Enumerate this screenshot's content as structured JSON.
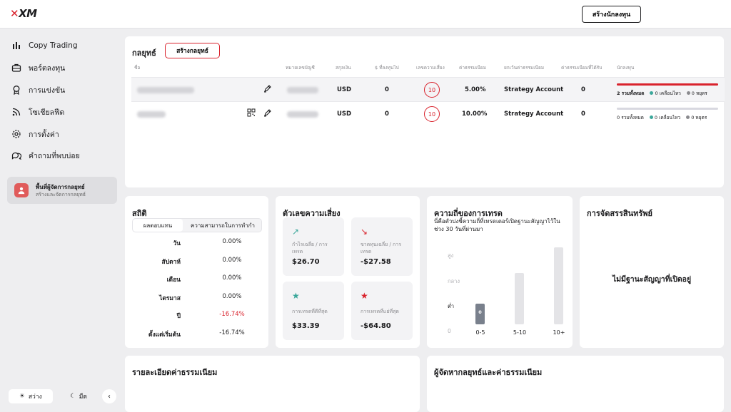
{
  "header": {
    "logo": "XM",
    "create_investor_button": "สร้างนักลงทุน"
  },
  "sidebar": {
    "items": [
      {
        "label": "Copy Trading",
        "icon": "bars-icon"
      },
      {
        "label": "พอร์ตลงทุน",
        "icon": "briefcase-icon"
      },
      {
        "label": "การแข่งขัน",
        "icon": "award-icon"
      },
      {
        "label": "โซเชียลฟีด",
        "icon": "rss-icon"
      },
      {
        "label": "การตั้งค่า",
        "icon": "gear-icon"
      },
      {
        "label": "คำถามที่พบบ่อย",
        "icon": "chat-icon"
      }
    ],
    "manager_area": {
      "title": "พื้นที่ผู้จัดการกลยุทธ์",
      "subtitle": "สร้างและจัดการกลยุทธ์"
    },
    "theme": {
      "light": "สว่าง",
      "dark": "มืด"
    }
  },
  "strategies": {
    "title": "กลยุทธ์",
    "create_button": "สร้างกลยุทธ์",
    "columns": [
      "ชื่อ",
      "หมายเลขบัญชี",
      "สกุลเงิน",
      "$ ที่ลงทุนไป",
      "เลขความเสี่ยง",
      "ค่าธรรมเนียม",
      "ยกเว้นค่าธรรมเนียม",
      "ค่าธรรมเนียมที่ได้รับ",
      "นักลงทุน"
    ],
    "rows": [
      {
        "currency": "USD",
        "invested": "0",
        "risk": "10",
        "fee": "5.00%",
        "fee_account": "Strategy Account",
        "fee_received": "0",
        "investors_total": "2 รวมทั้งหมด",
        "investors_active": "0 เคลื่อนไหว",
        "investors_stopped": "0 หยุดร",
        "bar_fill": 1.0,
        "bar_color": "#d9232d"
      },
      {
        "currency": "USD",
        "invested": "0",
        "risk": "10",
        "fee": "10.00%",
        "fee_account": "Strategy Account",
        "fee_received": "0",
        "investors_total": "0 รวมทั้งหมด",
        "investors_active": "0 เคลื่อนไหว",
        "investors_stopped": "0 หยุดร",
        "bar_fill": 0,
        "bar_color": "#d8d8e0"
      }
    ]
  },
  "statistics": {
    "title": "สถิติ",
    "tabs": [
      "ผลตอบแทน",
      "ความสามารถในการทำกำ"
    ],
    "rows": [
      {
        "label": "วัน",
        "value": "0.00%"
      },
      {
        "label": "สัปดาห์",
        "value": "0.00%"
      },
      {
        "label": "เดือน",
        "value": "0.00%"
      },
      {
        "label": "ไตรมาส",
        "value": "0.00%"
      },
      {
        "label": "ปี",
        "value": "-16.74%"
      },
      {
        "label": "ตั้งแต่เริ่มต้น",
        "value": "-16.74%"
      }
    ]
  },
  "risk_figures": {
    "title": "ตัวเลขความเสี่ยง",
    "tiles": [
      {
        "label": "กำไรเฉลี่ย / การเทรด",
        "value": "$26.70",
        "icon": "trend-up-icon",
        "color": "#3aa79a"
      },
      {
        "label": "ขาดทุนเฉลี่ย / การเทรด",
        "value": "-$27.58",
        "icon": "trend-down-icon",
        "color": "#d9232d"
      },
      {
        "label": "การเทรดที่ดีที่สุด",
        "value": "$33.39",
        "icon": "star-icon",
        "color": "#3aa79a"
      },
      {
        "label": "การเทรดที่แย่ที่สุด",
        "value": "-$64.80",
        "icon": "star-icon",
        "color": "#d9232d"
      }
    ]
  },
  "trade_frequency": {
    "title": "ความถี่ของการเทรด",
    "subtitle": "นี่คือตัวบ่งชี้ความถี่ที่เทรดเดอร์เปิดฐานะสัญญาไว้ในช่วง 30 วันที่ผ่านมา",
    "y_labels": [
      "สูง",
      "กลาง",
      "ต่ำ",
      "0"
    ],
    "chart_data": {
      "type": "bar",
      "categories": [
        "0-5",
        "5-10",
        "10+"
      ],
      "values": [
        0,
        null,
        null
      ],
      "active_category": "0-5",
      "value_label": "0"
    }
  },
  "asset_allocation": {
    "title": "การจัดสรรสินทรัพย์",
    "empty_text": "ไม่มีฐานะสัญญาที่เปิดอยู่"
  },
  "fee_details": {
    "title": "รายละเอียดค่าธรรมเนียม"
  },
  "managers_fees": {
    "title": "ผู้จัดหากลยุทธ์และค่าธรรมเนียม"
  }
}
